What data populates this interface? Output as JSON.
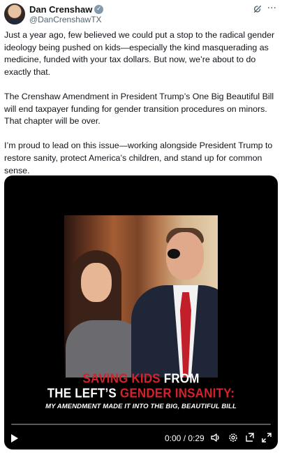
{
  "author": {
    "name": "Dan Crenshaw",
    "handle": "@DanCrenshawTX",
    "verified": true
  },
  "icons": {
    "verified": "verified-badge-icon",
    "grok": "grok-icon",
    "more": "more-options-icon"
  },
  "paragraphs": [
    "Just a year ago, few believed we could put a stop to the radical gender ideology being pushed on kids—especially the kind masquerading as medicine, funded with your tax dollars. But now, we’re about to do exactly that.",
    "The Crenshaw Amendment in President Trump’s One Big Beautiful Bill will end taxpayer funding for gender transition procedures on minors. That chapter will be over.",
    "I’m proud to lead on this issue—working alongside President Trump to restore sanity, protect America’s children, and stand up for common sense."
  ],
  "video": {
    "caption_line1": {
      "red": "SAVING KIDS",
      "white": " FROM"
    },
    "caption_line2": {
      "white": "THE LEFT’S ",
      "red": "GENDER INSANITY:"
    },
    "caption_line3": "MY AMENDMENT MADE IT INTO THE BIG, BEAUTIFUL BILL",
    "time": "0:00 / 0:29",
    "progress": 0,
    "controls": [
      "play-icon",
      "volume-icon",
      "settings-icon",
      "pip-icon",
      "fullscreen-icon"
    ]
  },
  "colors": {
    "accent": "#1d9bf0",
    "caption_red": "#d3222a",
    "verified_badge": "#829aab"
  }
}
